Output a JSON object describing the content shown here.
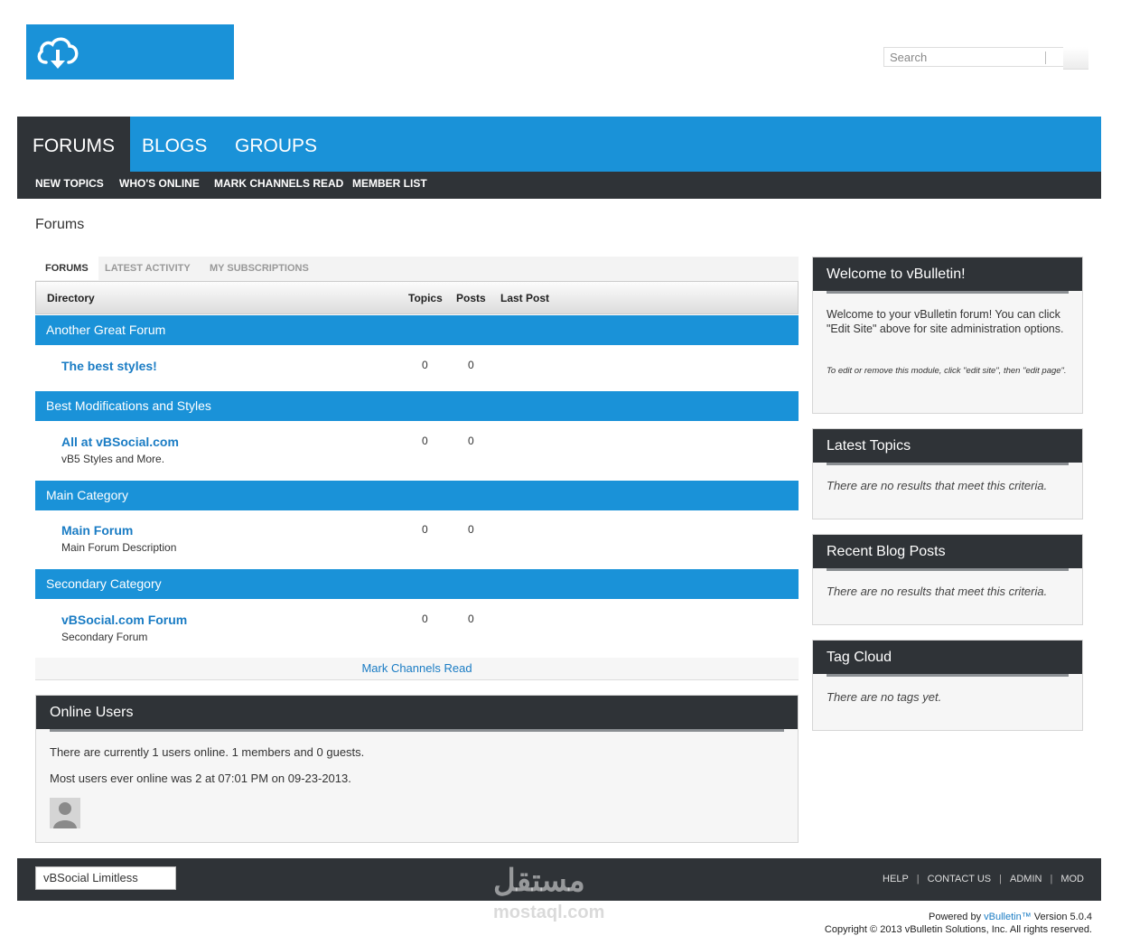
{
  "header": {
    "search_placeholder": "Search"
  },
  "mainnav": {
    "tabs": [
      {
        "label": "FORUMS",
        "active": true
      },
      {
        "label": "BLOGS",
        "active": false
      },
      {
        "label": "GROUPS",
        "active": false
      }
    ]
  },
  "subnav": {
    "items": [
      "NEW TOPICS",
      "WHO'S ONLINE",
      "MARK CHANNELS READ",
      "MEMBER LIST"
    ]
  },
  "page": {
    "title": "Forums"
  },
  "tabs": {
    "items": [
      {
        "label": "FORUMS",
        "active": true
      },
      {
        "label": "LATEST ACTIVITY",
        "active": false
      },
      {
        "label": "MY SUBSCRIPTIONS",
        "active": false
      }
    ]
  },
  "directory": {
    "columns": {
      "directory": "Directory",
      "topics": "Topics",
      "posts": "Posts",
      "last_post": "Last Post"
    },
    "categories": [
      {
        "title": "Another Great Forum",
        "forum": {
          "name": "The best styles!",
          "desc": "",
          "topics": "0",
          "posts": "0"
        }
      },
      {
        "title": "Best Modifications and Styles",
        "forum": {
          "name": "All at vBSocial.com",
          "desc": "vB5 Styles and More.",
          "topics": "0",
          "posts": "0"
        }
      },
      {
        "title": "Main Category",
        "forum": {
          "name": "Main Forum",
          "desc": "Main Forum Description",
          "topics": "0",
          "posts": "0"
        }
      },
      {
        "title": "Secondary Category",
        "forum": {
          "name": "vBSocial.com Forum",
          "desc": "Secondary Forum",
          "topics": "0",
          "posts": "0"
        }
      }
    ],
    "mark_read": "Mark Channels Read"
  },
  "online": {
    "title": "Online Users",
    "line1": "There are currently 1 users online. 1 members and 0 guests.",
    "line2": "Most users ever online was 2 at 07:01 PM on 09-23-2013."
  },
  "sidebar": {
    "welcome": {
      "title": "Welcome to vBulletin!",
      "text": "Welcome to your vBulletin forum! You can click \"Edit Site\" above for site administration options.",
      "note": "To edit or remove this module, click \"edit site\", then \"edit page\"."
    },
    "latest_topics": {
      "title": "Latest Topics",
      "text": "There are no results that meet this criteria."
    },
    "recent_blog": {
      "title": "Recent Blog Posts",
      "text": "There are no results that meet this criteria."
    },
    "tag_cloud": {
      "title": "Tag Cloud",
      "text": "There are no tags yet."
    }
  },
  "footer": {
    "style_select": "vBSocial Limitless",
    "links": [
      "HELP",
      "CONTACT US",
      "ADMIN",
      "MOD"
    ],
    "powered_prefix": "Powered by ",
    "powered_link": "vBulletin™",
    "powered_suffix": " Version 5.0.4",
    "copyright": "Copyright © 2013 vBulletin Solutions, Inc. All rights reserved."
  },
  "watermark": {
    "arabic": "مستقل",
    "latin": "mostaql.com"
  },
  "colors": {
    "brand_blue": "#1a92d8",
    "dark": "#2f3337",
    "link": "#1a7cc4"
  }
}
